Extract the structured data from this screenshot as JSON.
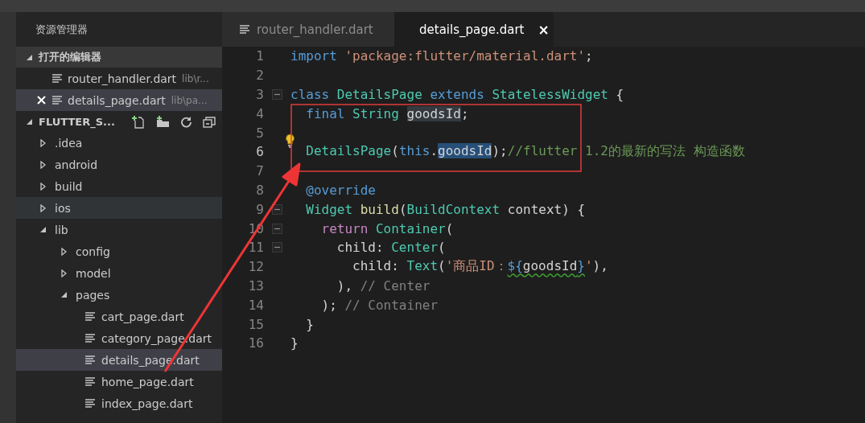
{
  "sidebar": {
    "title": "资源管理器",
    "open_editors": {
      "title": "打开的编辑器",
      "expanded": true,
      "items": [
        {
          "name": "router_handler.dart",
          "path": "lib\\r...",
          "selected": false
        },
        {
          "name": "details_page.dart",
          "path": "lib\\pa...",
          "selected": true
        }
      ]
    },
    "project": {
      "title": "FLUTTER_S...",
      "expanded": true
    },
    "tree": [
      {
        "name": ".idea",
        "kind": "folder",
        "expanded": false,
        "selected": false
      },
      {
        "name": "android",
        "kind": "folder",
        "expanded": false,
        "selected": false
      },
      {
        "name": "build",
        "kind": "folder",
        "expanded": false,
        "selected": false
      },
      {
        "name": "ios",
        "kind": "folder",
        "expanded": false,
        "selected": false,
        "hovered": true
      },
      {
        "name": "lib",
        "kind": "folder",
        "expanded": true,
        "selected": false,
        "children": [
          {
            "name": "config",
            "kind": "folder",
            "expanded": false,
            "selected": false
          },
          {
            "name": "model",
            "kind": "folder",
            "expanded": false,
            "selected": false
          },
          {
            "name": "pages",
            "kind": "folder",
            "expanded": true,
            "selected": false,
            "children": [
              {
                "name": "cart_page.dart",
                "kind": "file",
                "selected": false
              },
              {
                "name": "category_page.dart",
                "kind": "file",
                "selected": false
              },
              {
                "name": "details_page.dart",
                "kind": "file",
                "selected": true
              },
              {
                "name": "home_page.dart",
                "kind": "file",
                "selected": false
              },
              {
                "name": "index_page.dart",
                "kind": "file",
                "selected": false
              }
            ]
          }
        ]
      }
    ]
  },
  "tabs": [
    {
      "label": "router_handler.dart",
      "selected": false
    },
    {
      "label": "details_page.dart",
      "selected": true,
      "close": "×"
    }
  ],
  "editor": {
    "lines": [
      {
        "number": "1",
        "tokens": [
          {
            "t": "import ",
            "kind": "kw"
          },
          {
            "t": "'package:flutter/material.dart'",
            "kind": "str"
          },
          {
            "t": ";",
            "kind": "plain"
          }
        ]
      },
      {
        "number": "2"
      },
      {
        "number": "3",
        "fold": true,
        "tokens": [
          {
            "t": "class ",
            "kind": "kw"
          },
          {
            "t": "DetailsPage ",
            "kind": "type"
          },
          {
            "t": "extends ",
            "kind": "kw"
          },
          {
            "t": "StatelessWidget ",
            "kind": "type"
          },
          {
            "t": "{",
            "kind": "plain"
          }
        ]
      },
      {
        "number": "4",
        "tokens": [
          {
            "t": "  final ",
            "kind": "kw"
          },
          {
            "t": "String ",
            "kind": "type"
          },
          {
            "t": "goodsId",
            "kind": "plain",
            "highlighted": true
          },
          {
            "t": ";",
            "kind": "plain"
          }
        ]
      },
      {
        "number": "5",
        "lightbulb": true
      },
      {
        "number": "6",
        "current": true,
        "tokens": [
          {
            "t": "  DetailsPage",
            "kind": "type"
          },
          {
            "t": "(",
            "kind": "plain"
          },
          {
            "t": "this",
            "kind": "kw"
          },
          {
            "t": ".",
            "kind": "plain"
          },
          {
            "t": "goodsId",
            "kind": "plain",
            "selected": true
          },
          {
            "t": ");",
            "kind": "plain"
          },
          {
            "t": "//flutter 1.2的最新的写法 构造函数",
            "kind": "cmt"
          }
        ]
      },
      {
        "number": "7"
      },
      {
        "number": "8",
        "tokens": [
          {
            "t": "  @override",
            "kind": "kw"
          }
        ]
      },
      {
        "number": "9",
        "fold": true,
        "tokens": [
          {
            "t": "  Widget ",
            "kind": "type"
          },
          {
            "t": "build",
            "kind": "fn"
          },
          {
            "t": "(",
            "kind": "plain"
          },
          {
            "t": "BuildContext ",
            "kind": "type"
          },
          {
            "t": "context) {",
            "kind": "plain"
          }
        ]
      },
      {
        "number": "10",
        "fold": true,
        "tokens": [
          {
            "t": "    return ",
            "kind": "ctrl"
          },
          {
            "t": "Container",
            "kind": "type"
          },
          {
            "t": "(",
            "kind": "plain"
          }
        ]
      },
      {
        "number": "11",
        "fold": true,
        "tokens": [
          {
            "t": "      child: ",
            "kind": "plain"
          },
          {
            "t": "Center",
            "kind": "type"
          },
          {
            "t": "(",
            "kind": "plain"
          }
        ]
      },
      {
        "number": "12",
        "tokens": [
          {
            "t": "        child: ",
            "kind": "plain"
          },
          {
            "t": "Text",
            "kind": "type"
          },
          {
            "t": "(",
            "kind": "plain"
          },
          {
            "t": "'商品ID：",
            "kind": "str"
          },
          {
            "t": "${",
            "kind": "kw",
            "warning": true
          },
          {
            "t": "goodsId",
            "kind": "plain",
            "warning": true
          },
          {
            "t": "}",
            "kind": "kw",
            "warning": true
          },
          {
            "t": "'",
            "kind": "str"
          },
          {
            "t": "),",
            "kind": "plain"
          }
        ]
      },
      {
        "number": "13",
        "tokens": [
          {
            "t": "      ), ",
            "kind": "plain"
          },
          {
            "t": "// Center",
            "kind": "label"
          }
        ]
      },
      {
        "number": "14",
        "tokens": [
          {
            "t": "    ); ",
            "kind": "plain"
          },
          {
            "t": "// Container",
            "kind": "label"
          }
        ]
      },
      {
        "number": "15",
        "tokens": [
          {
            "t": "  }",
            "kind": "plain"
          }
        ]
      },
      {
        "number": "16",
        "tokens": [
          {
            "t": "}",
            "kind": "plain"
          }
        ]
      }
    ]
  },
  "annotations": [
    {
      "kind": "box"
    },
    {
      "kind": "arrow"
    }
  ]
}
